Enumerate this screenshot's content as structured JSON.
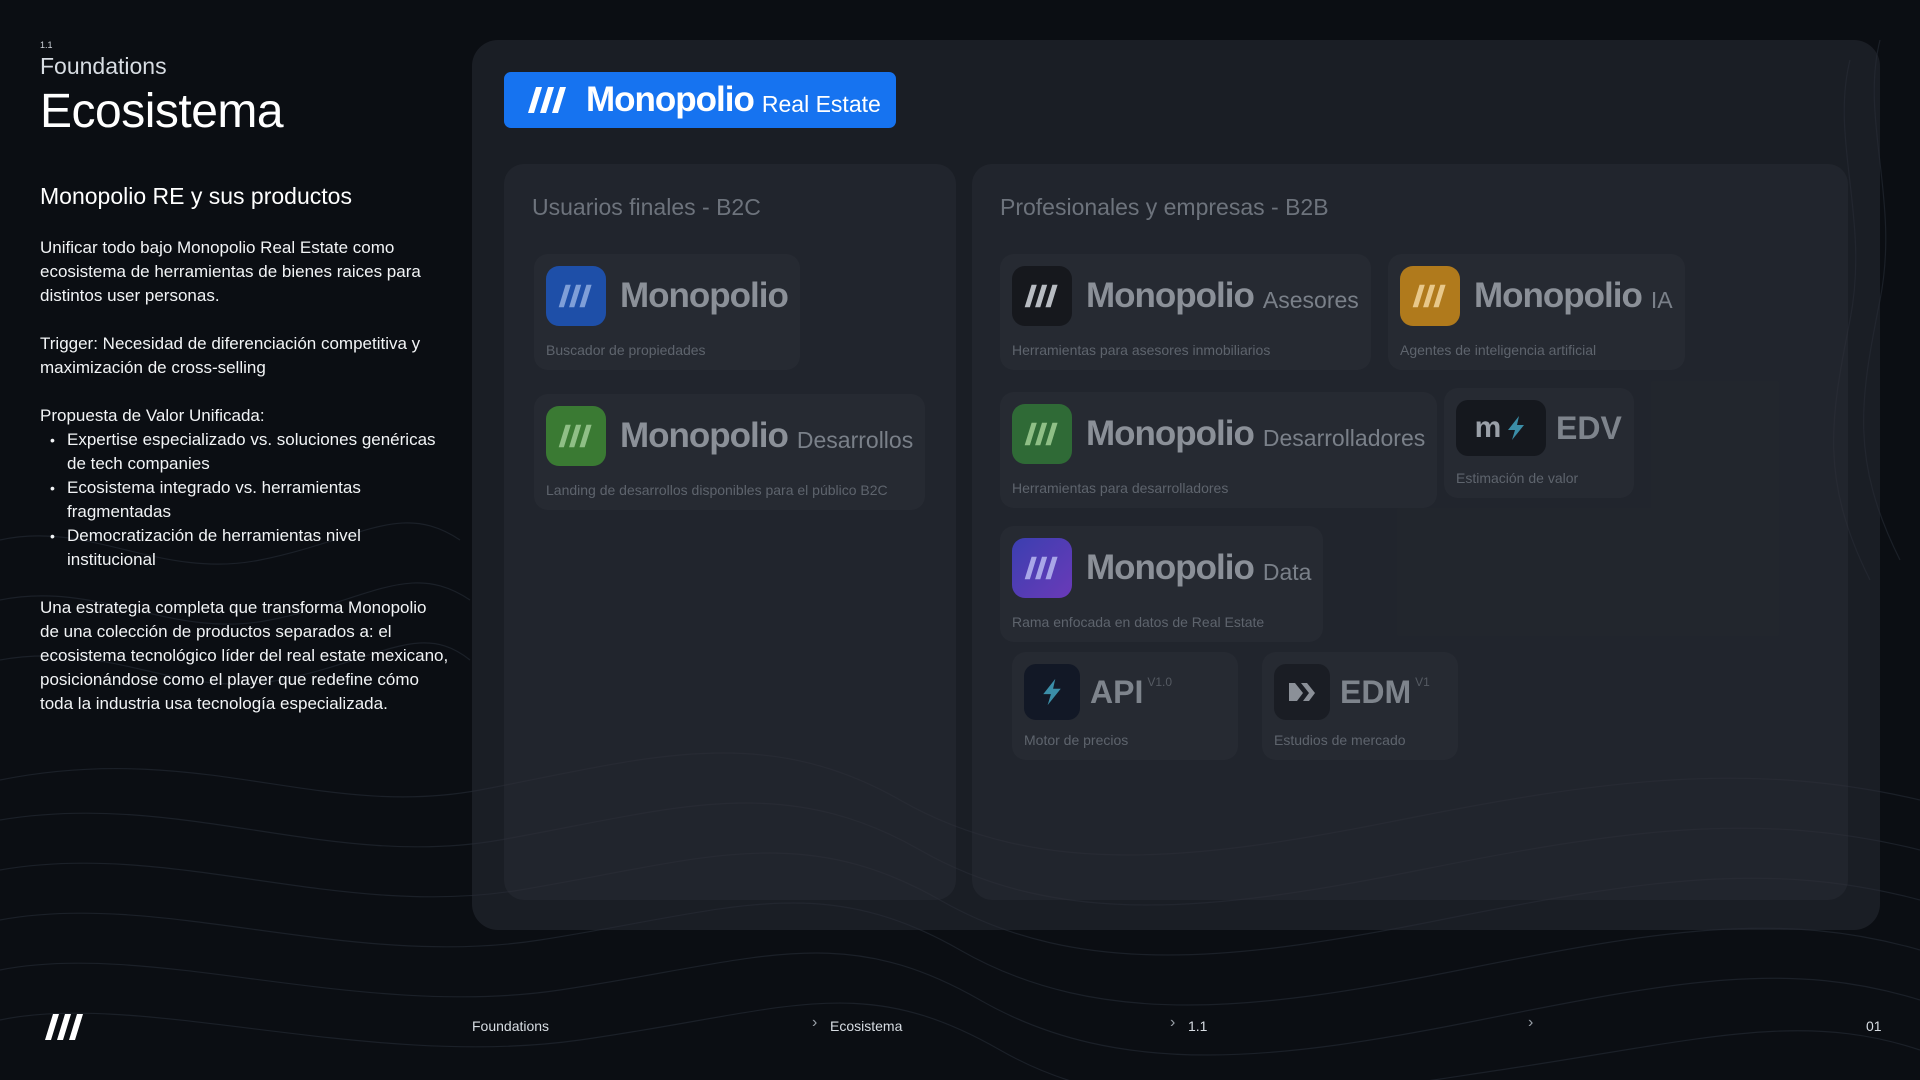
{
  "header": {
    "section_number": "1.1",
    "section_name": "Foundations",
    "title": "Ecosistema"
  },
  "intro": {
    "subtitle": "Monopolio RE y sus productos",
    "paragraph_1": "Unificar todo bajo Monopolio Real Estate como ecosistema de herramientas de bienes raices para distintos user personas.",
    "paragraph_2": "Trigger: Necesidad de diferenciación competitiva y maximización de cross-selling",
    "value_prop_title": "Propuesta de Valor Unificada:",
    "bullets": [
      "Expertise especializado vs. soluciones genéricas de tech companies",
      "Ecosistema integrado vs. herramientas fragmentadas",
      "Democratización de herramientas nivel institucional"
    ],
    "paragraph_3": "Una estrategia completa que transforma Monopolio de una colección de productos separados a: el ecosistema tecnológico líder del real estate mexicano, posicionándose como el player que redefine cómo toda la industria usa tecnología especializada."
  },
  "brand": {
    "name": "Monopolio",
    "suffix": "Real Estate",
    "color": "#1673f0"
  },
  "b2c": {
    "title": "Usuarios finales - B2C",
    "products": [
      {
        "name": "Monopolio",
        "suffix": "",
        "desc": "Buscador de propiedades",
        "color": "#1e4fa8"
      },
      {
        "name": "Monopolio",
        "suffix": "Desarrollos",
        "desc": "Landing de desarrollos disponibles para el público B2C",
        "color": "#3a7a33"
      }
    ]
  },
  "b2b": {
    "title": "Profesionales y empresas - B2B",
    "products": [
      {
        "name": "Monopolio",
        "suffix": "Asesores",
        "desc": "Herramientas para asesores inmobiliarios",
        "color": "#16181d"
      },
      {
        "name": "Monopolio",
        "suffix": "IA",
        "desc": "Agentes de inteligencia artificial",
        "color": "#b07a1c"
      },
      {
        "name": "Monopolio",
        "suffix": "Desarrolladores",
        "desc": "Herramientas para desarrolladores",
        "color": "#2f6a36"
      },
      {
        "name": "Monopolio",
        "suffix": "Data",
        "desc": "Rama enfocada en datos de Real Estate",
        "color": "#4b40b8"
      }
    ],
    "edv": {
      "logo_letter": "m",
      "name": "EDV",
      "desc": "Estimación de valor"
    },
    "api": {
      "name": "API",
      "version": "V1.0",
      "desc": "Motor de precios"
    },
    "edm": {
      "name": "EDM",
      "version": "V1",
      "desc": "Estudios de mercado"
    }
  },
  "footer": {
    "crumb_1": "Foundations",
    "crumb_2": "Ecosistema",
    "crumb_3": "1.1",
    "page": "01"
  }
}
